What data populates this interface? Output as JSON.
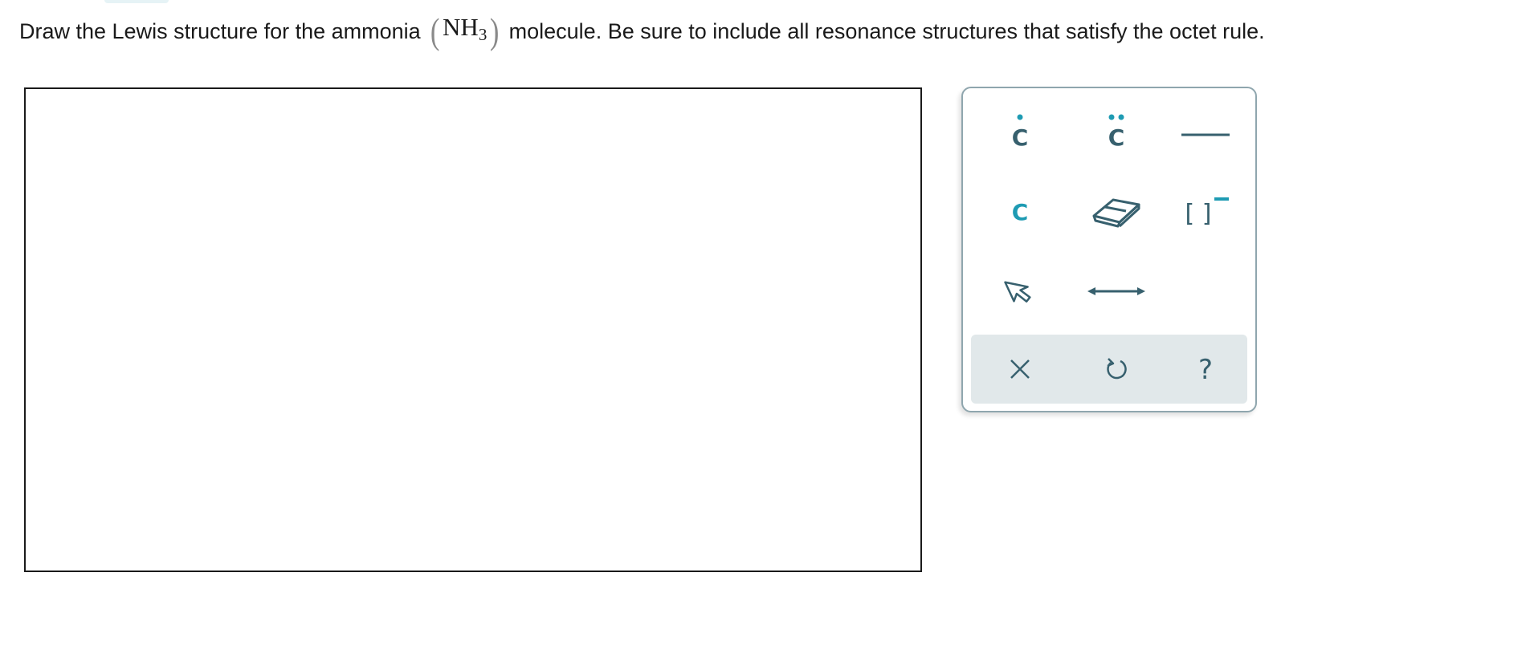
{
  "question": {
    "prefix": "Draw the Lewis structure for the ammonia",
    "formula_main": "NH",
    "formula_sub": "3",
    "paren_open": "(",
    "paren_close": ")",
    "suffix": "molecule. Be sure to include all resonance structures that satisfy the octet rule."
  },
  "palette": {
    "tools": [
      {
        "name": "radical-atom",
        "glyph": "C",
        "icon": "single-dot-atom-icon",
        "color": "#37606e"
      },
      {
        "name": "lone-pair-atom",
        "glyph": "C",
        "icon": "lone-pair-atom-icon",
        "color": "#37606e"
      },
      {
        "name": "single-bond",
        "icon": "bond-line-icon",
        "color": "#37606e"
      },
      {
        "name": "atom",
        "glyph": "C",
        "icon": "atom-icon",
        "color": "#1e9bb3"
      },
      {
        "name": "eraser",
        "icon": "eraser-icon",
        "color": "#37606e"
      },
      {
        "name": "charge-bracket",
        "glyph": "[ ]",
        "icon": "bracket-charge-icon",
        "color": "#37606e",
        "charge_color": "#1e9bb3"
      },
      {
        "name": "select",
        "icon": "cursor-icon",
        "color": "#37606e"
      },
      {
        "name": "resonance-arrow",
        "icon": "double-arrow-icon",
        "color": "#37606e"
      }
    ],
    "actions": [
      {
        "name": "clear",
        "icon": "close-icon"
      },
      {
        "name": "undo",
        "icon": "undo-icon"
      },
      {
        "name": "help",
        "glyph": "?",
        "icon": "help-icon"
      }
    ],
    "colors": {
      "icon": "#37606e",
      "accent": "#1e9bb3",
      "border": "#8fa6ae",
      "footer_bg": "#e1e8ea"
    }
  }
}
